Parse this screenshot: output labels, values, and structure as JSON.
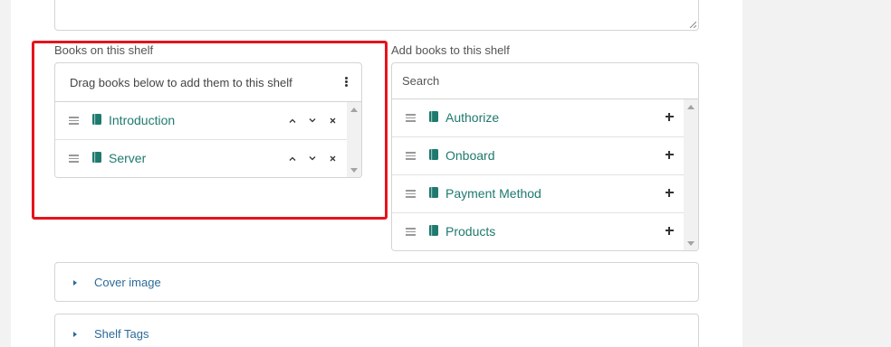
{
  "shelf": {
    "label": "Books on this shelf",
    "header": "Drag books below to add them to this shelf",
    "items": [
      {
        "label": "Introduction",
        "icon": "book-icon"
      },
      {
        "label": "Server",
        "icon": "book-icon"
      }
    ],
    "controls": {
      "up": "^",
      "down": "⌄",
      "remove": "×"
    }
  },
  "add_books": {
    "label": "Add books to this shelf",
    "search_placeholder": "Search",
    "items": [
      {
        "label": "Authorize",
        "icon": "book-icon"
      },
      {
        "label": "Onboard",
        "icon": "book-icon"
      },
      {
        "label": "Payment Method",
        "icon": "book-icon"
      },
      {
        "label": "Products",
        "icon": "book-icon"
      }
    ]
  },
  "sections": {
    "cover_image": "Cover image",
    "shelf_tags": "Shelf Tags"
  },
  "colors": {
    "book_label": "#1e7a6e",
    "book_icon": "#1e7a6e",
    "section_link": "#2b6a9a",
    "highlight": "#e5131d"
  }
}
